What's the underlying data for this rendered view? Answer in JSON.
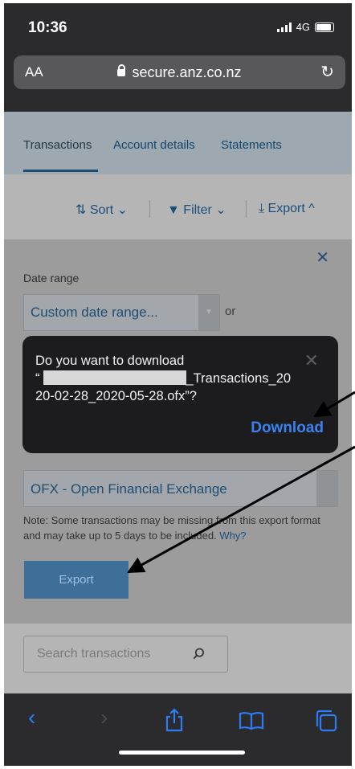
{
  "status": {
    "time": "10:36",
    "network": "4G"
  },
  "browser": {
    "aa": "AA",
    "url": "secure.anz.co.nz",
    "reload_icon": "reload-icon"
  },
  "tabs": [
    {
      "label": "Transactions",
      "active": true
    },
    {
      "label": "Account details"
    },
    {
      "label": "Statements"
    }
  ],
  "toolbar": {
    "sort": "Sort",
    "filter": "Filter",
    "export": "Export"
  },
  "export_panel": {
    "date_range_label": "Date range",
    "date_range_value": "Custom date range...",
    "or_text": "or",
    "format_value": "OFX - Open Financial Exchange",
    "note": "Note: Some transactions may be missing from this export format and may take up to 5 days to be included.",
    "why_link": "Why?",
    "export_button": "Export"
  },
  "search": {
    "placeholder": "Search transactions"
  },
  "dialog": {
    "line1": "Do you want to download",
    "quote_open": "“",
    "filename_part1": "_Transactions_20",
    "filename_part2": "20-02-28_2020-05-28.ofx”?",
    "download_button": "Download"
  },
  "colors": {
    "accent": "#3b82f0",
    "anz_blue": "#1b4f7a",
    "export_button": "#3d6f99"
  }
}
